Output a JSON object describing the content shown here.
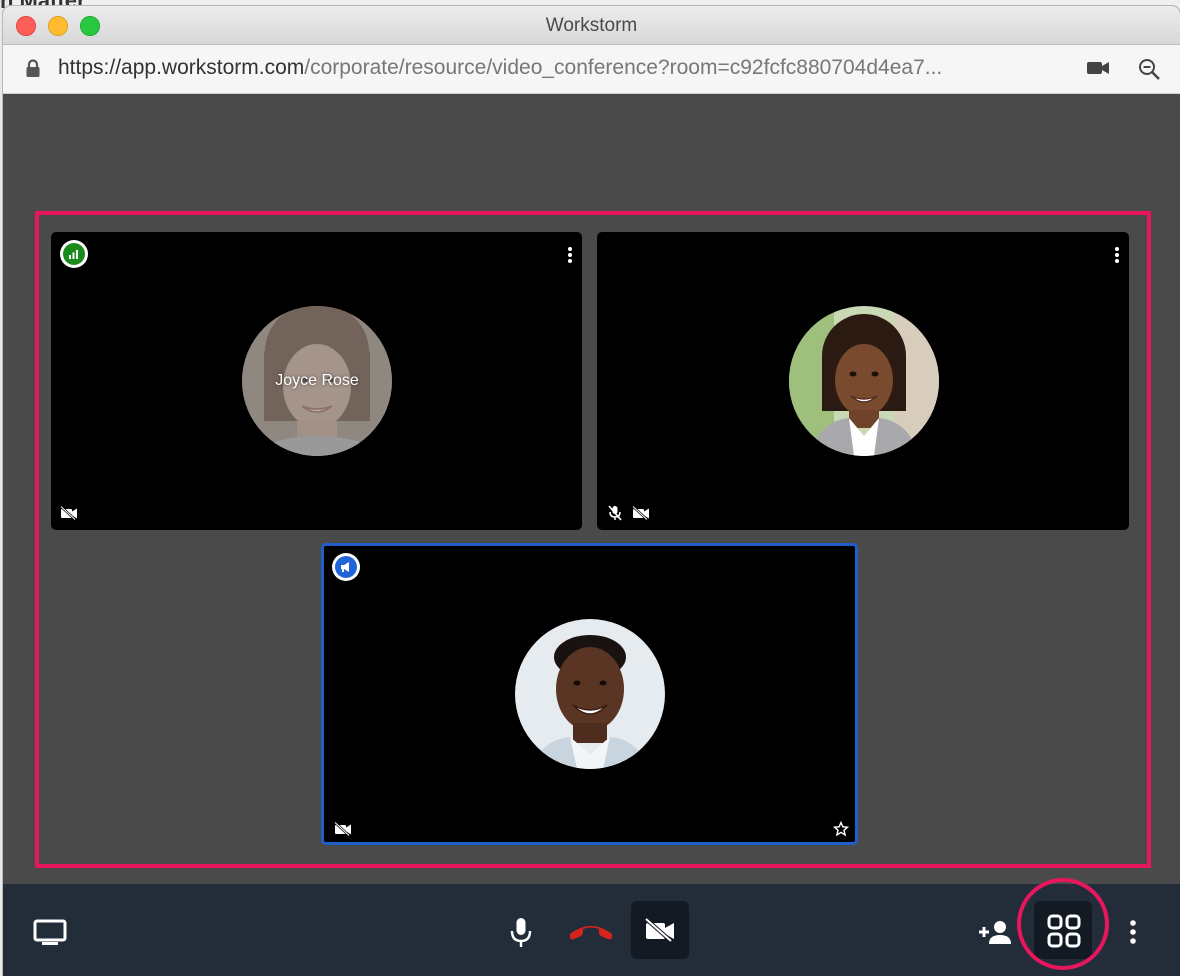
{
  "background": {
    "app_title_fragment": "n Matter"
  },
  "window": {
    "title": "Workstorm",
    "url_host": "https://app.workstorm.com",
    "url_path": "/corporate/resource/video_conference?room=c92fcfc880704d4ea7..."
  },
  "participants": [
    {
      "name": "Joyce Rose",
      "badge": "signal-bars-icon",
      "badge_color": "#1a8a1a",
      "mic_muted": false,
      "video_off": true,
      "active_speaker": false
    },
    {
      "name": "",
      "badge": "",
      "mic_muted": true,
      "video_off": true,
      "active_speaker": false
    },
    {
      "name": "",
      "badge": "megaphone-icon",
      "badge_color": "#2065d8",
      "mic_muted": false,
      "video_off": true,
      "active_speaker": true
    }
  ],
  "colors": {
    "highlight": "#e8175d",
    "active_border": "#1e5fc9",
    "toolbar_bg": "#232c39",
    "hangup": "#d8231c"
  },
  "toolbar": {
    "left": [
      "screen-share-icon"
    ],
    "center": [
      "microphone-icon",
      "hang-up-icon",
      "video-off-icon"
    ],
    "right": [
      "add-participant-icon",
      "tile-view-icon",
      "more-options-icon"
    ]
  }
}
